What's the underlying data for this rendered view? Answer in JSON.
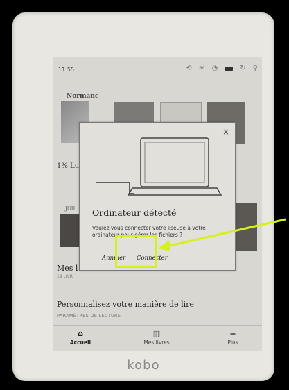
{
  "device": {
    "brand": "kobo"
  },
  "status_bar": {
    "time": "11:55",
    "icons": [
      "sync-icon",
      "brightness-icon",
      "wifi-icon",
      "battery-icon",
      "refresh-icon",
      "search-icon"
    ]
  },
  "library": {
    "series_title": "Normanc",
    "progress_text": "1% Lu",
    "month_label": "JUIL",
    "shelf_title": "Mes l",
    "shelf_sub": "19 LIVR",
    "personalize_title": "Personnalisez votre manière de lire",
    "personalize_sub": "PARAMÈTRES DE LECTURE"
  },
  "dialog": {
    "close_glyph": "×",
    "title": "Ordinateur détecté",
    "body": "Voulez-vous connecter votre liseuse à votre ordinateur pour gérer les fichiers ?",
    "cancel_label": "Annuler",
    "connect_label": "Connecter"
  },
  "nav": {
    "home_label": "Accueil",
    "books_label": "Mes livres",
    "more_label": "Plus"
  },
  "annotation": {
    "color": "#d6f01f"
  }
}
